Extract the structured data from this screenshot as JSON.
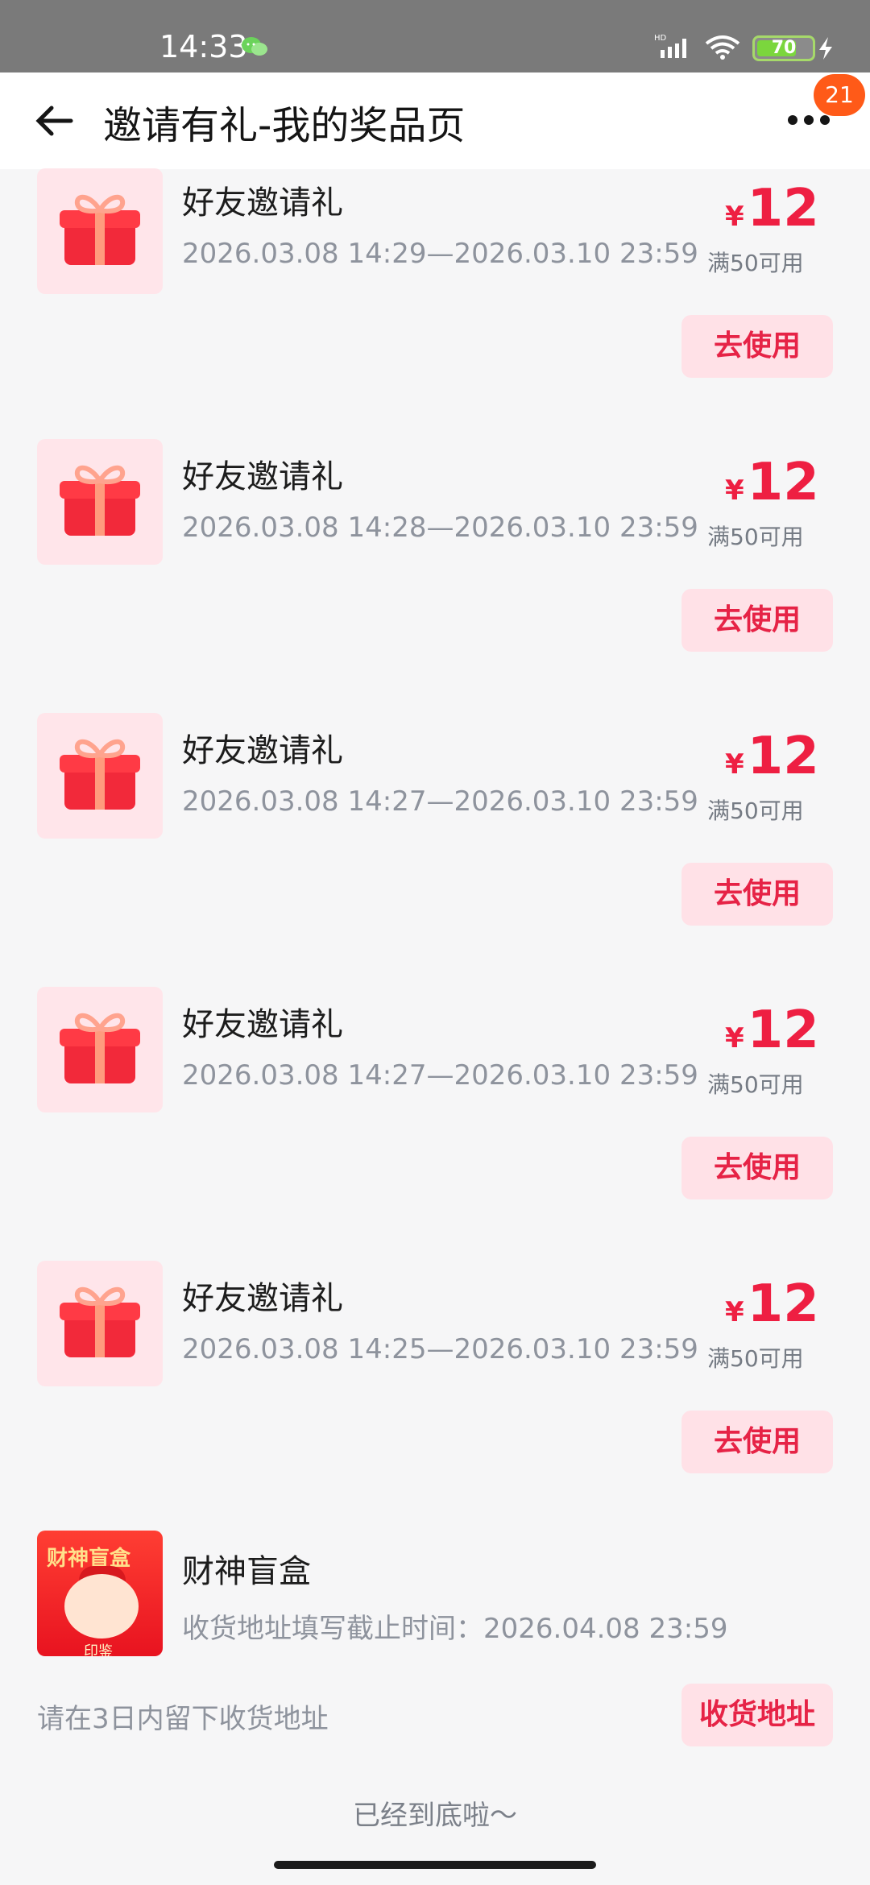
{
  "status": {
    "time": "14:33",
    "battery": "70"
  },
  "header": {
    "title": "邀请有礼-我的奖品页",
    "badge": "21"
  },
  "prizes": [
    {
      "name": "好友邀请礼",
      "time": "2026.03.08 14:29—2026.03.10 23:59",
      "currency": "¥",
      "amount": "12",
      "threshold": "满50可用",
      "button": "去使用"
    },
    {
      "name": "好友邀请礼",
      "time": "2026.03.08 14:28—2026.03.10 23:59",
      "currency": "¥",
      "amount": "12",
      "threshold": "满50可用",
      "button": "去使用"
    },
    {
      "name": "好友邀请礼",
      "time": "2026.03.08 14:27—2026.03.10 23:59",
      "currency": "¥",
      "amount": "12",
      "threshold": "满50可用",
      "button": "去使用"
    },
    {
      "name": "好友邀请礼",
      "time": "2026.03.08 14:27—2026.03.10 23:59",
      "currency": "¥",
      "amount": "12",
      "threshold": "满50可用",
      "button": "去使用"
    },
    {
      "name": "好友邀请礼",
      "time": "2026.03.08 14:25—2026.03.10 23:59",
      "currency": "¥",
      "amount": "12",
      "threshold": "满50可用",
      "button": "去使用"
    }
  ],
  "box": {
    "name": "财神盲盒",
    "deadline": "收货地址填写截止时间：2026.04.08 23:59",
    "note": "请在3日内留下收货地址",
    "button": "收货地址",
    "thumb_title": "财神盲盒",
    "thumb_badge": "印鉴"
  },
  "footer": {
    "end_text": "已经到底啦～"
  }
}
